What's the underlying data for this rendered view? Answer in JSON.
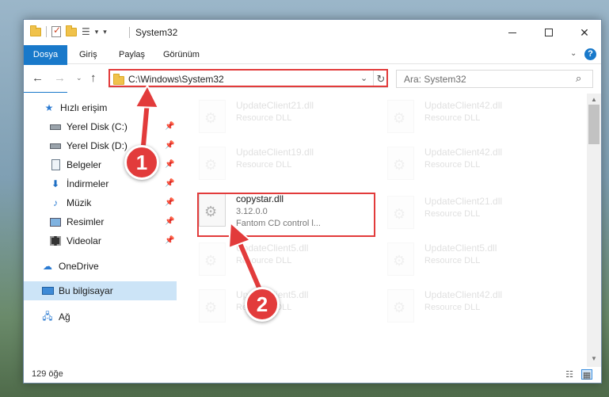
{
  "window": {
    "title": "System32"
  },
  "ribbon": {
    "tabs": [
      "Dosya",
      "Giriş",
      "Paylaş",
      "Görünüm"
    ],
    "help_glyph": "?"
  },
  "navbar": {
    "address": "C:\\Windows\\System32",
    "search_placeholder": "Ara: System32"
  },
  "sidebar": {
    "items": [
      {
        "label": "Hızlı erişim",
        "icon": "quick-access-icon"
      },
      {
        "label": "Yerel Disk (C:)",
        "icon": "drive-icon",
        "pinned": true
      },
      {
        "label": "Yerel Disk (D:)",
        "icon": "drive-icon",
        "pinned": true
      },
      {
        "label": "Belgeler",
        "icon": "documents-icon",
        "pinned": true
      },
      {
        "label": "İndirmeler",
        "icon": "downloads-icon",
        "pinned": true
      },
      {
        "label": "Müzik",
        "icon": "music-icon",
        "pinned": true
      },
      {
        "label": "Resimler",
        "icon": "pictures-icon",
        "pinned": true
      },
      {
        "label": "Videolar",
        "icon": "videos-icon",
        "pinned": true
      },
      {
        "label": "OneDrive",
        "icon": "cloud-icon"
      },
      {
        "label": "Bu bilgisayar",
        "icon": "computer-icon",
        "selected": true
      },
      {
        "label": "Ağ",
        "icon": "network-icon"
      }
    ]
  },
  "files": {
    "left": [
      {
        "name": "UpdateClient21.dll",
        "sub": "Resource DLL"
      },
      {
        "name": "UpdateClient19.dll",
        "sub": "Resource DLL"
      },
      {
        "name": "copystar.dll",
        "version": "3.12.0.0",
        "desc": "Fantom CD control l..."
      },
      {
        "name": "UpdateClient5.dll",
        "sub": "Resource DLL"
      },
      {
        "name": "UpdateClient5.dll",
        "sub": "Resource DLL"
      }
    ],
    "right": [
      {
        "name": "UpdateClient42.dll",
        "sub": "Resource DLL"
      },
      {
        "name": "UpdateClient42.dll",
        "sub": "Resource DLL"
      },
      {
        "name": "UpdateClient21.dll",
        "sub": "Resource DLL"
      },
      {
        "name": "UpdateClient5.dll",
        "sub": "Resource DLL"
      },
      {
        "name": "UpdateClient42.dll",
        "sub": "Resource DLL"
      }
    ]
  },
  "status": {
    "count": "129 öğe"
  },
  "annotations": {
    "step1": "1",
    "step2": "2",
    "color": "#e23b3b"
  }
}
